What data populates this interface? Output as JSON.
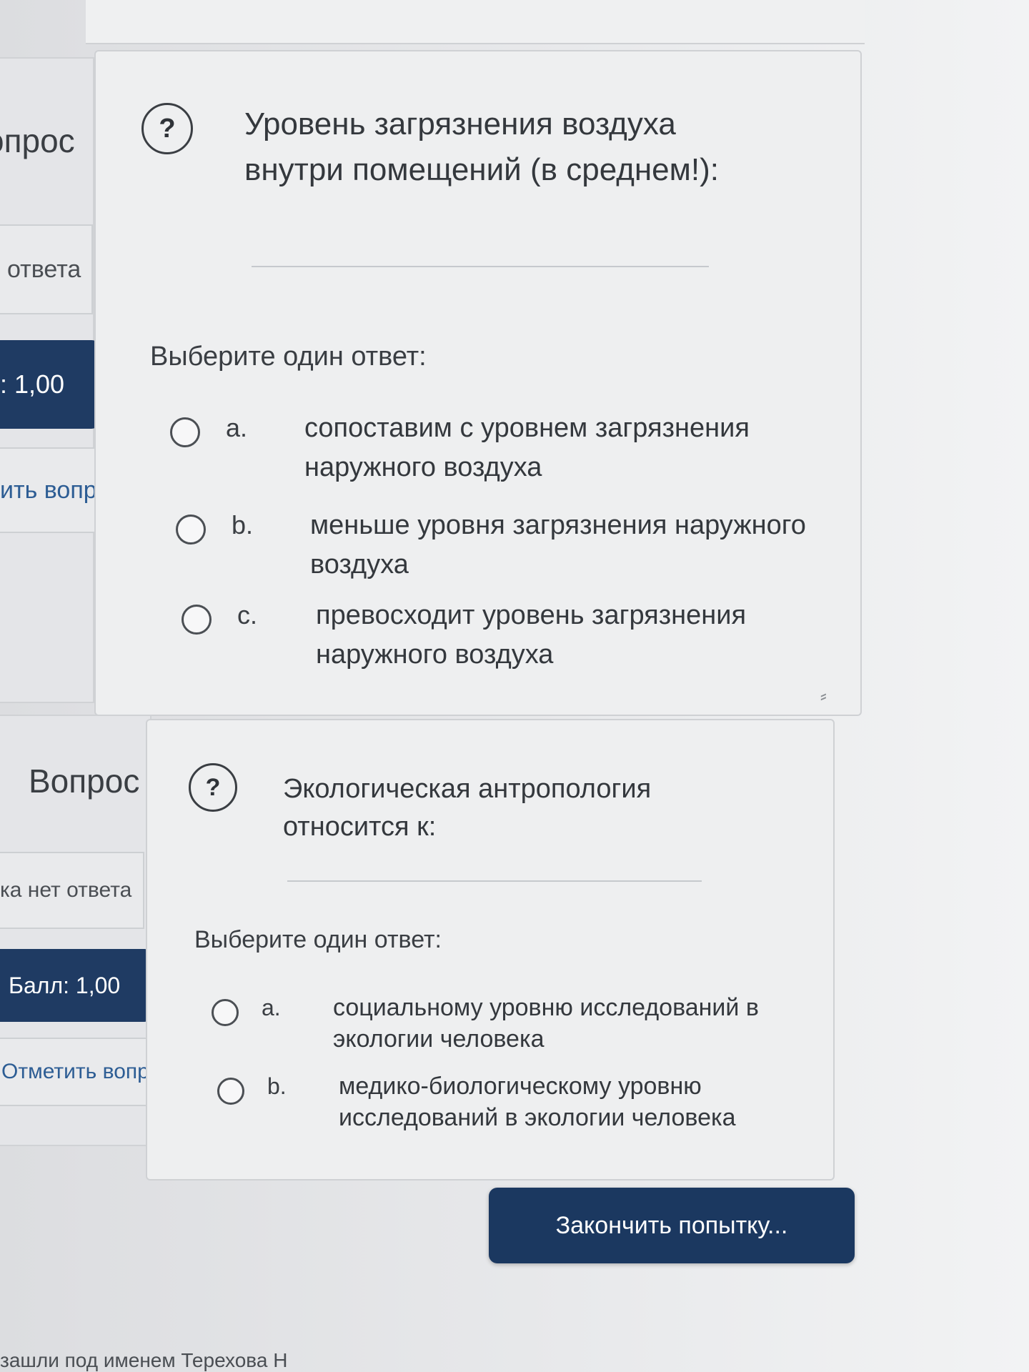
{
  "questions": [
    {
      "info": {
        "number_label": "опрос",
        "status": "ответа",
        "grade": ": 1,00",
        "flag": "ить вопрос"
      },
      "help_icon": "?",
      "text": "Уровень загрязнения воздуха внутри помещений (в среднем!):",
      "prompt": "Выберите один ответ:",
      "options": [
        {
          "letter": "a.",
          "text": "сопоставим с уровнем загрязнения наружного воздуха"
        },
        {
          "letter": "b.",
          "text": "меньше уровня загрязнения наружного воздуха"
        },
        {
          "letter": "c.",
          "text": "превосходит уровень загрязнения наружного воздуха"
        }
      ]
    },
    {
      "info": {
        "number_label": "Вопрос",
        "status": "ка нет ответа",
        "grade": "Балл: 1,00",
        "flag": "Отметить вопрос"
      },
      "help_icon": "?",
      "text": "Экологическая антропология относится к:",
      "prompt": "Выберите один ответ:",
      "options": [
        {
          "letter": "a.",
          "text": "социальному уровню исследований в экологии человека"
        },
        {
          "letter": "b.",
          "text": "медико-биологическому уровню исследований в экологии человека"
        }
      ]
    }
  ],
  "finish_button": "Закончить попытку...",
  "footer": "зашли под именем Терехова Н"
}
